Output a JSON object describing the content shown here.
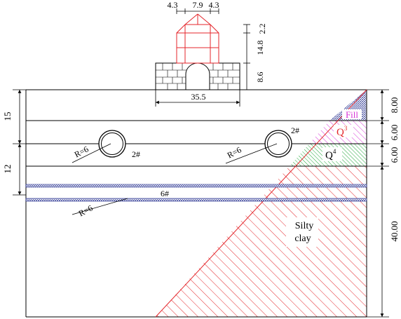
{
  "building": {
    "dim_top_left": "4.3",
    "dim_top_mid": "7.9",
    "dim_top_right": "4.3",
    "dim_roof_height": "2.2",
    "dim_upper_height": "14.8",
    "dim_base_height": "8.6",
    "dim_base_width": "35.5"
  },
  "left_dims": {
    "upper": "15",
    "lower": "12"
  },
  "right_dims": {
    "fill": "8.00",
    "q3": "6.00",
    "q4": "6.00",
    "silty_clay": "40.00"
  },
  "tunnels": {
    "left_radius": "R=6",
    "left_label": "2#",
    "right_radius": "R=6",
    "right_label": "2#",
    "lower_label": "6#",
    "lower_radius": "R=6"
  },
  "layers": {
    "fill": "Fill",
    "q3_base": "Q",
    "q3_sup": "3",
    "q4_base": "Q",
    "q4_sup": "4",
    "silty_line1": "Silty",
    "silty_line2": "clay"
  },
  "colors": {
    "building": "#e4262b",
    "fill": "#1f2a8c",
    "q3": "#d62fd6",
    "q4": "#22a83a",
    "silty_clay": "#e4262b",
    "pipe_band": "#1f2a8c"
  }
}
